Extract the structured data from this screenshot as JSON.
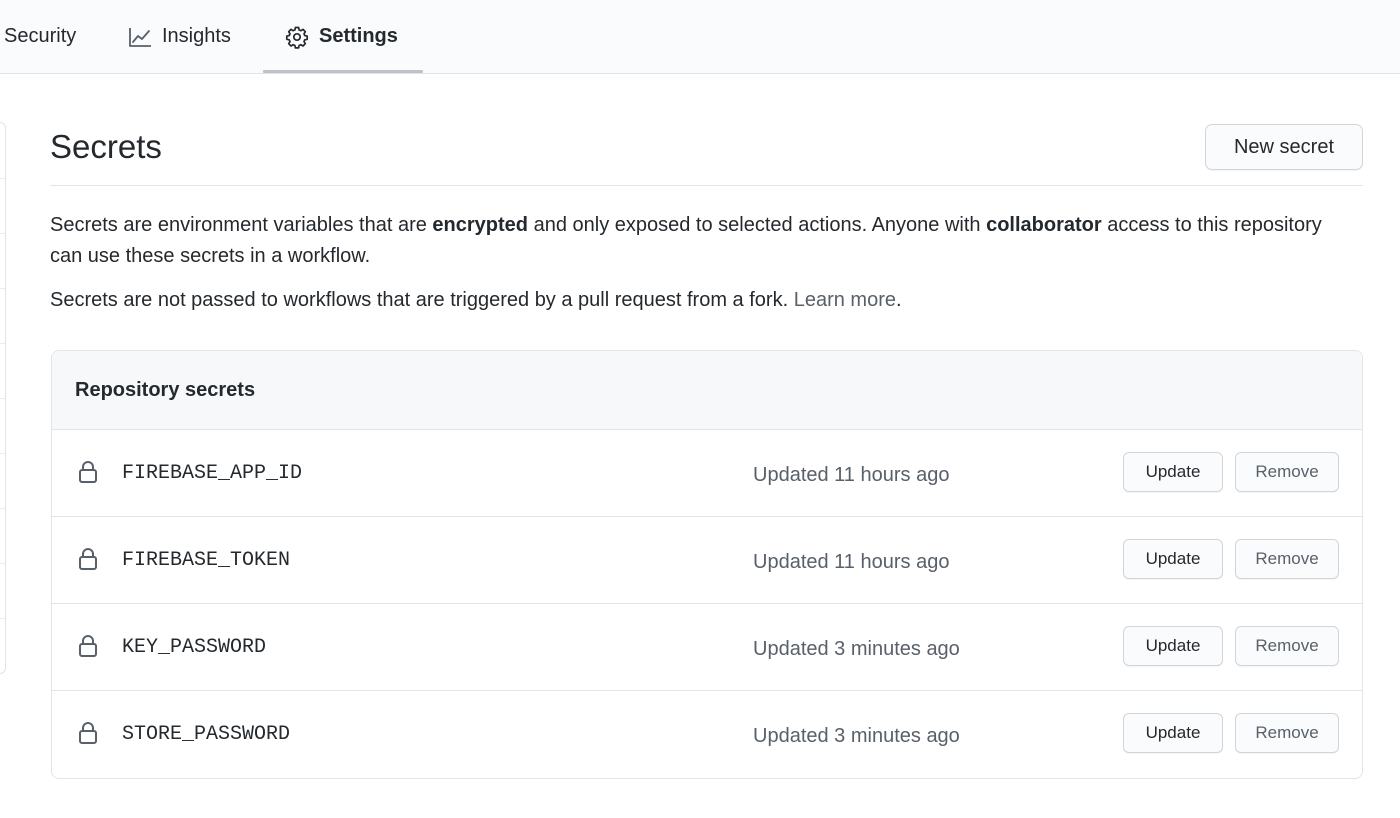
{
  "nav": {
    "tabs": [
      {
        "label": "Security",
        "icon": "shield-icon"
      },
      {
        "label": "Insights",
        "icon": "graph-icon"
      },
      {
        "label": "Settings",
        "icon": "gear-icon",
        "selected": true
      }
    ]
  },
  "header": {
    "title": "Secrets",
    "new_secret_label": "New secret"
  },
  "description": {
    "p1_a": "Secrets are environment variables that are ",
    "p1_b": "encrypted",
    "p1_c": " and only exposed to selected actions. Anyone with ",
    "p1_d": "collaborator",
    "p1_e": " access to this repository can use these secrets in a workflow.",
    "p2_a": "Secrets are not passed to workflows that are triggered by a pull request from a fork. ",
    "p2_link": "Learn more",
    "p2_b": "."
  },
  "secrets_box": {
    "title": "Repository secrets",
    "update_label": "Update",
    "remove_label": "Remove",
    "rows": [
      {
        "name": "FIREBASE_APP_ID",
        "updated": "Updated 11 hours ago"
      },
      {
        "name": "FIREBASE_TOKEN",
        "updated": "Updated 11 hours ago"
      },
      {
        "name": "KEY_PASSWORD",
        "updated": "Updated 3 minutes ago"
      },
      {
        "name": "STORE_PASSWORD",
        "updated": "Updated 3 minutes ago"
      }
    ]
  },
  "colors": {
    "text": "#24292e",
    "muted": "#586069",
    "border": "#e1e4e8",
    "header_bg": "#f6f8fa"
  }
}
